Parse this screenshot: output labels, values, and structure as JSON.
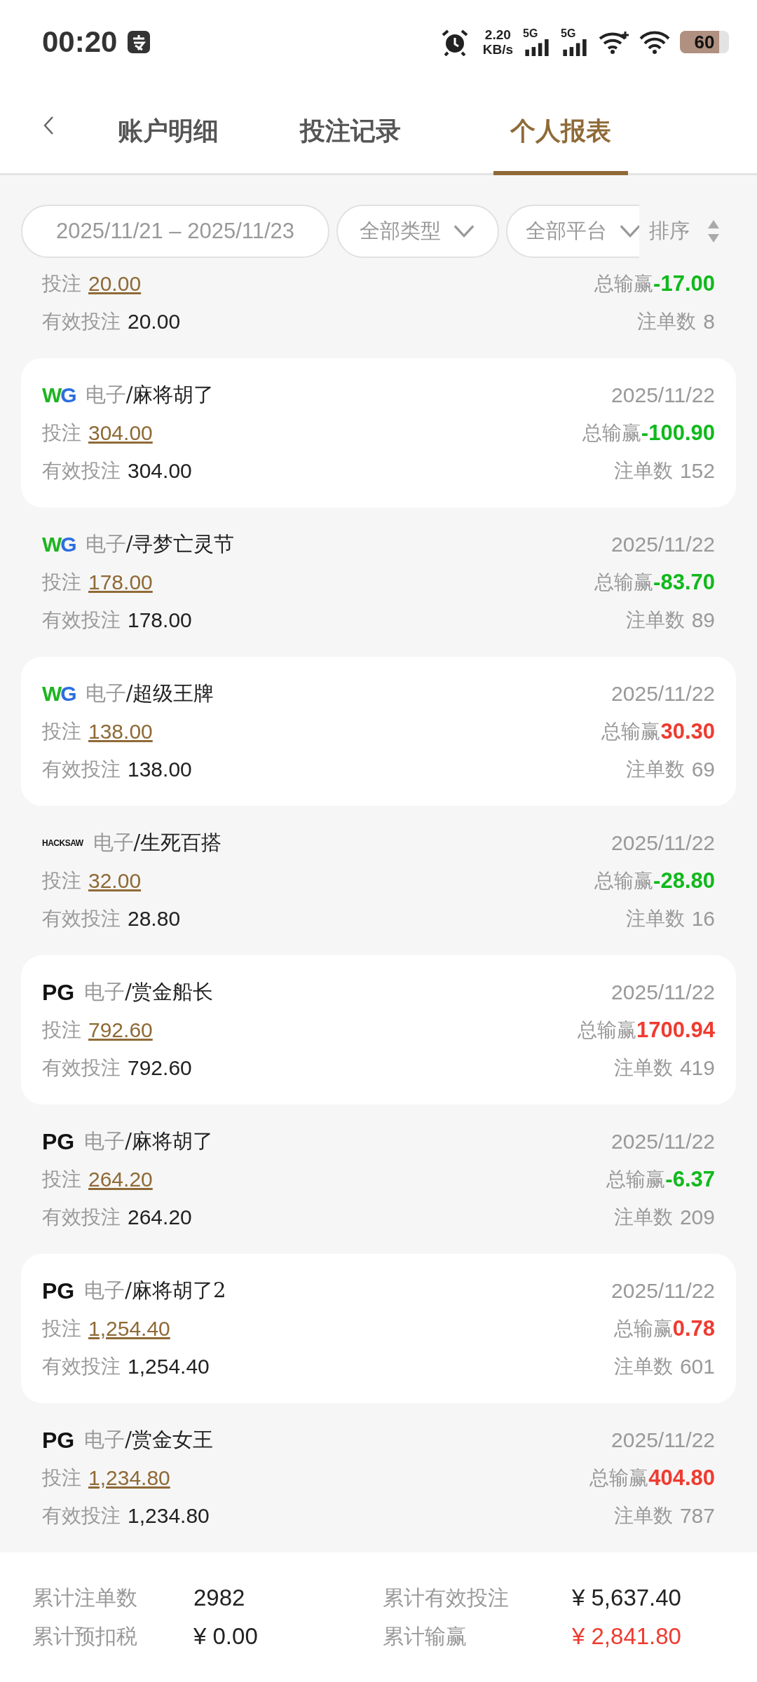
{
  "status_bar": {
    "time": "00:20",
    "speed_value": "2.20",
    "speed_unit": "KB/s",
    "network_1": "5G",
    "network_2": "5G",
    "battery": "60"
  },
  "tabs": [
    {
      "label": "账户明细",
      "selected": false
    },
    {
      "label": "投注记录",
      "selected": false
    },
    {
      "label": "个人报表",
      "selected": true
    }
  ],
  "filters": {
    "date_range": "2025/11/21 – 2025/11/23",
    "type": "全部类型",
    "platform": "全部平台",
    "sort": "排序"
  },
  "records": [
    {
      "bet_label": "投注",
      "bet": "20.00",
      "valid_label": "有效投注",
      "valid_bet": "20.00",
      "win_label": "总输赢",
      "win": "-17.00",
      "color": "#10b91c",
      "count_label": "注单数",
      "count": "8"
    },
    {
      "logo": {
        "kind": "wg",
        "text": "WG"
      },
      "category": "电子",
      "game": "/麻将胡了",
      "date": "2025/11/22",
      "bet_label": "投注",
      "bet": "304.00",
      "valid_label": "有效投注",
      "valid_bet": "304.00",
      "win_label": "总输赢",
      "win": "-100.90",
      "color": "#10b91c",
      "count_label": "注单数",
      "count": "152"
    },
    {
      "logo": {
        "kind": "wg",
        "text": "WG"
      },
      "category": "电子",
      "game": "/寻梦亡灵节",
      "date": "2025/11/22",
      "bet_label": "投注",
      "bet": "178.00",
      "valid_label": "有效投注",
      "valid_bet": "178.00",
      "win_label": "总输赢",
      "win": "-83.70",
      "color": "#10b91c",
      "count_label": "注单数",
      "count": "89"
    },
    {
      "logo": {
        "kind": "wg",
        "text": "WG"
      },
      "category": "电子",
      "game": "/超级王牌",
      "date": "2025/11/22",
      "bet_label": "投注",
      "bet": "138.00",
      "valid_label": "有效投注",
      "valid_bet": "138.00",
      "win_label": "总输赢",
      "win": "30.30",
      "color": "#ef3b30",
      "count_label": "注单数",
      "count": "69"
    },
    {
      "logo": {
        "kind": "hacksaw",
        "text": "HACKSAW"
      },
      "category": "电子",
      "game": "/生死百搭",
      "date": "2025/11/22",
      "bet_label": "投注",
      "bet": "32.00",
      "valid_label": "有效投注",
      "valid_bet": "28.80",
      "win_label": "总输赢",
      "win": "-28.80",
      "color": "#10b91c",
      "count_label": "注单数",
      "count": "16"
    },
    {
      "logo": {
        "kind": "pg",
        "text": "PG"
      },
      "category": "电子",
      "game": "/赏金船长",
      "date": "2025/11/22",
      "bet_label": "投注",
      "bet": "792.60",
      "valid_label": "有效投注",
      "valid_bet": "792.60",
      "win_label": "总输赢",
      "win": "1700.94",
      "color": "#ef3b30",
      "count_label": "注单数",
      "count": "419"
    },
    {
      "logo": {
        "kind": "pg",
        "text": "PG"
      },
      "category": "电子",
      "game": "/麻将胡了",
      "date": "2025/11/22",
      "bet_label": "投注",
      "bet": "264.20",
      "valid_label": "有效投注",
      "valid_bet": "264.20",
      "win_label": "总输赢",
      "win": "-6.37",
      "color": "#10b91c",
      "count_label": "注单数",
      "count": "209"
    },
    {
      "logo": {
        "kind": "pg",
        "text": "PG"
      },
      "category": "电子",
      "game": "/麻将胡了2",
      "date": "2025/11/22",
      "bet_label": "投注",
      "bet": "1,254.40",
      "valid_label": "有效投注",
      "valid_bet": "1,254.40",
      "win_label": "总输赢",
      "win": "0.78",
      "color": "#ef3b30",
      "count_label": "注单数",
      "count": "601"
    },
    {
      "logo": {
        "kind": "pg",
        "text": "PG"
      },
      "category": "电子",
      "game": "/赏金女王",
      "date": "2025/11/22",
      "bet_label": "投注",
      "bet": "1,234.80",
      "valid_label": "有效投注",
      "valid_bet": "1,234.80",
      "win_label": "总输赢",
      "win": "404.80",
      "color": "#ef3b30",
      "count_label": "注单数",
      "count": "787"
    }
  ],
  "totals": [
    {
      "label": "累计注单数",
      "value": "2982",
      "color": "#222222"
    },
    {
      "label": "累计有效投注",
      "value": "¥ 5,637.40",
      "color": "#222222"
    },
    {
      "label": "累计预扣税",
      "value": "¥ 0.00",
      "color": "#222222"
    },
    {
      "label": "累计输赢",
      "value": "¥ 2,841.80",
      "color": "#ef3b30"
    }
  ]
}
